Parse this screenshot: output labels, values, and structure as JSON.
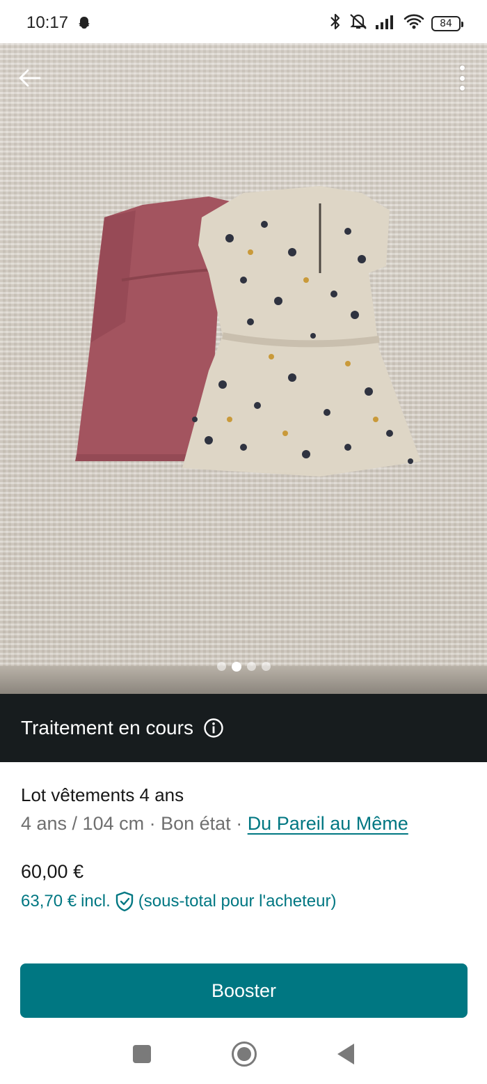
{
  "status_bar": {
    "time": "10:17",
    "battery": "84",
    "icons": [
      "snapchat-ghost-icon",
      "bluetooth-icon",
      "mute-icon",
      "signal-icon",
      "wifi-icon",
      "battery-icon"
    ]
  },
  "photo": {
    "image_count": 4,
    "active_index": 1,
    "icons": [
      "back-arrow-icon",
      "more-vertical-icon"
    ]
  },
  "banner": {
    "text": "Traitement en cours",
    "icon": "info-icon"
  },
  "item": {
    "title": "Lot vêtements 4 ans",
    "size": "4 ans / 104 cm",
    "separator": " · ",
    "condition": "Bon état",
    "brand": "Du Pareil au Même",
    "price": "60,00 €",
    "buyer_price": "63,70 €",
    "incl_label": "incl.",
    "buyer_note": "(sous-total pour l'acheteur)"
  },
  "actions": {
    "booster_label": "Booster"
  },
  "colors": {
    "accent": "#007782",
    "banner_bg": "#171c1e",
    "text_primary": "#171717",
    "text_secondary": "#6f6f6f"
  }
}
